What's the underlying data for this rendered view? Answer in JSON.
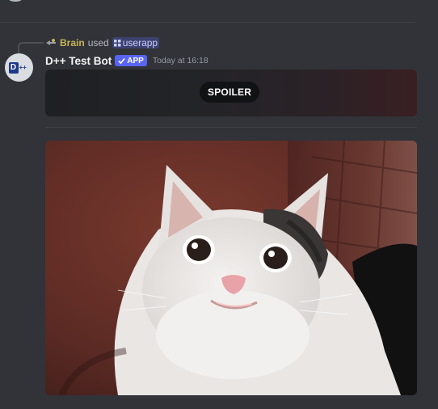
{
  "reply": {
    "user_name": "Brain",
    "used_text": "used",
    "command_name": "userapp"
  },
  "message": {
    "username": "D++ Test Bot",
    "badge": "APP",
    "timestamp": "Today at 16:18",
    "spoiler_label": "SPOILER"
  },
  "colors": {
    "background": "#313338",
    "badge": "#5865f2",
    "reply_name": "#c9b458",
    "mention": "#c9cdfb"
  },
  "icons": {
    "reply_avatar": "reply-avatar-icon",
    "command": "slash-command-icon",
    "badge_check": "check-icon"
  }
}
